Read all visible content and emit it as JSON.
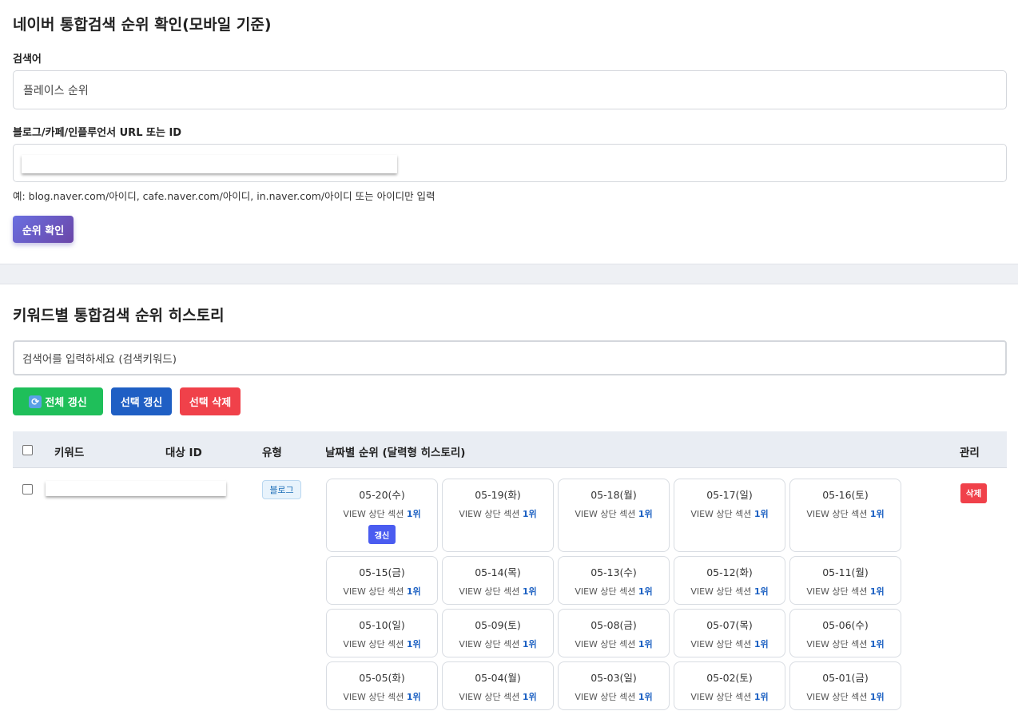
{
  "rank_check": {
    "title": "네이버 통합검색 순위 확인(모바일 기준)",
    "keyword_label": "검색어",
    "keyword_value": "플레이스 순위",
    "url_label": "블로그/카페/인플루언서 URL 또는 ID",
    "url_hint": "예: blog.naver.com/아이디, cafe.naver.com/아이디, in.naver.com/아이디 또는 아이디만 입력",
    "check_button": "순위 확인"
  },
  "history": {
    "title": "키워드별 통합검색 순위 히스토리",
    "search_placeholder": "검색어를 입력하세요 (검색키워드)",
    "btn_refresh_all": "전체 갱신",
    "btn_refresh_selected": "선택 갱신",
    "btn_delete_selected": "선택 삭제",
    "columns": {
      "keyword": "키워드",
      "target_id": "대상 ID",
      "type": "유형",
      "daily_rank": "날짜별 순위 (달력형 히스토리)",
      "manage": "관리"
    },
    "row": {
      "type": "블로그",
      "delete": "삭제",
      "refresh": "갱신",
      "rank_prefix": "VIEW 상단 섹션",
      "days": [
        {
          "date": "05-20(수)",
          "rank": "1위"
        },
        {
          "date": "05-19(화)",
          "rank": "1위"
        },
        {
          "date": "05-18(월)",
          "rank": "1위"
        },
        {
          "date": "05-17(일)",
          "rank": "1위"
        },
        {
          "date": "05-16(토)",
          "rank": "1위"
        },
        {
          "date": "05-15(금)",
          "rank": "1위"
        },
        {
          "date": "05-14(목)",
          "rank": "1위"
        },
        {
          "date": "05-13(수)",
          "rank": "1위"
        },
        {
          "date": "05-12(화)",
          "rank": "1위"
        },
        {
          "date": "05-11(월)",
          "rank": "1위"
        },
        {
          "date": "05-10(일)",
          "rank": "1위"
        },
        {
          "date": "05-09(토)",
          "rank": "1위"
        },
        {
          "date": "05-08(금)",
          "rank": "1위"
        },
        {
          "date": "05-07(목)",
          "rank": "1위"
        },
        {
          "date": "05-06(수)",
          "rank": "1위"
        },
        {
          "date": "05-05(화)",
          "rank": "1위"
        },
        {
          "date": "05-04(월)",
          "rank": "1위"
        },
        {
          "date": "05-03(일)",
          "rank": "1위"
        },
        {
          "date": "05-02(토)",
          "rank": "1위"
        },
        {
          "date": "05-01(금)",
          "rank": "1위"
        }
      ]
    }
  }
}
